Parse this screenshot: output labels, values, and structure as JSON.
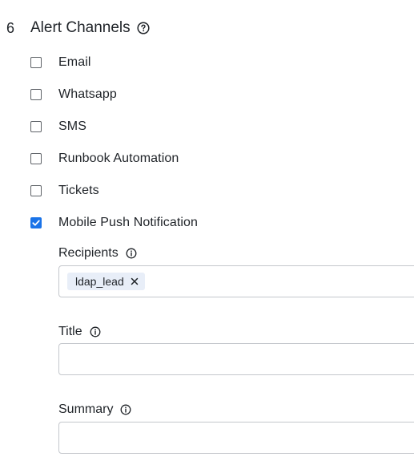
{
  "section": {
    "number": "6",
    "title": "Alert Channels",
    "help_icon": "question-circle-icon"
  },
  "channels": [
    {
      "label": "Email",
      "checked": false
    },
    {
      "label": "Whatsapp",
      "checked": false
    },
    {
      "label": "SMS",
      "checked": false
    },
    {
      "label": "Runbook Automation",
      "checked": false
    },
    {
      "label": "Tickets",
      "checked": false
    },
    {
      "label": "Mobile Push Notification",
      "checked": true
    }
  ],
  "mobile_push": {
    "recipients": {
      "label": "Recipients",
      "info_icon": "info-circle-icon",
      "chips": [
        {
          "label": "ldap_lead",
          "remove_icon": "close-icon"
        }
      ]
    },
    "title": {
      "label": "Title",
      "info_icon": "info-circle-icon",
      "value": ""
    },
    "summary": {
      "label": "Summary",
      "info_icon": "info-circle-icon",
      "value": ""
    }
  },
  "colors": {
    "accent": "#1a73e8",
    "chip_bg": "#e8eef8",
    "border": "#c4c7cc",
    "text": "#1f2328"
  }
}
